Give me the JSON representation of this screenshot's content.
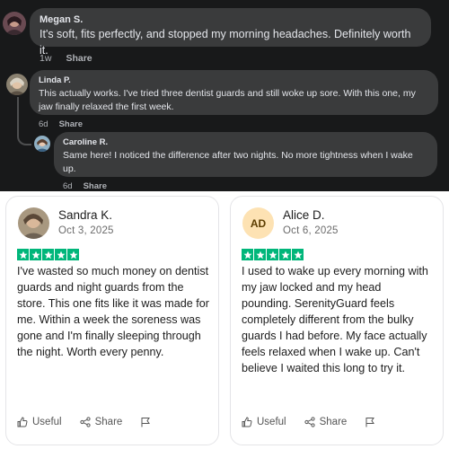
{
  "comments": [
    {
      "name": "Megan S.",
      "text": "It's soft, fits perfectly, and stopped my morning headaches. Definitely worth it.",
      "time": "1w",
      "share_label": "Share"
    },
    {
      "name": "Linda P.",
      "text": "This actually works. I've tried three dentist guards and still woke up sore. With this one, my jaw finally relaxed the first week.",
      "time": "6d",
      "share_label": "Share"
    },
    {
      "name": "Caroline R.",
      "text": "Same here! I noticed the difference after two nights. No more tightness when I wake up.",
      "time": "6d",
      "share_label": "Share"
    }
  ],
  "reviews": [
    {
      "name": "Sandra K.",
      "date": "Oct 3, 2025",
      "rating": 5,
      "body": "I've wasted so much money on dentist guards and night guards from the store. This one fits like it was made for me. Within a week the soreness was gone and I'm finally sleeping through the night. Worth every penny.",
      "useful_label": "Useful",
      "share_label": "Share"
    },
    {
      "name": "Alice D.",
      "initials": "AD",
      "date": "Oct 6, 2025",
      "rating": 5,
      "body": "I used to wake up every morning with my jaw locked and my head pounding. SerenityGuard feels completely different from the bulky guards I had before. My face actually feels relaxed when I wake up. Can't believe I waited this long to try it.",
      "useful_label": "Useful",
      "share_label": "Share"
    }
  ],
  "colors": {
    "fb_background": "#18191a",
    "bubble": "#3a3b3c",
    "star_green": "#00b67a",
    "initials_avatar": "#fde2b3"
  },
  "icons": [
    "thumbs-up-icon",
    "share-icon",
    "flag-icon",
    "star-icon"
  ]
}
